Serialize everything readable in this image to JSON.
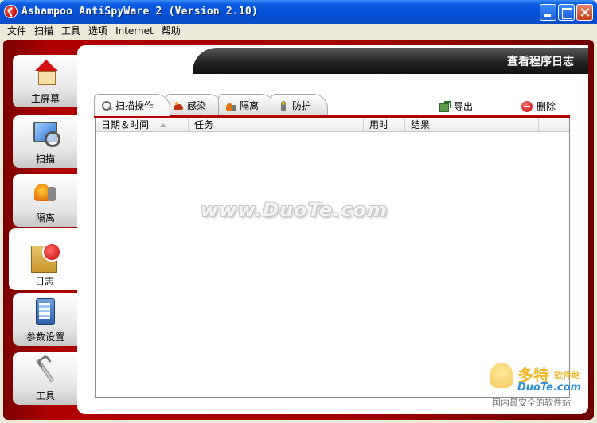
{
  "window": {
    "title": "Ashampoo AntiSpyWare 2 (Version 2.10)"
  },
  "menu": [
    "文件",
    "扫描",
    "工具",
    "选项",
    "Internet",
    "帮助"
  ],
  "sidebar": {
    "items": [
      {
        "label": "主屏幕",
        "icon": "home-icon"
      },
      {
        "label": "扫描",
        "icon": "scan-icon"
      },
      {
        "label": "隔离",
        "icon": "quarantine-icon"
      },
      {
        "label": "日志",
        "icon": "log-icon",
        "active": true
      },
      {
        "label": "参数设置",
        "icon": "settings-icon"
      },
      {
        "label": "工具",
        "icon": "tools-icon"
      }
    ]
  },
  "header": {
    "title": "查看程序日志"
  },
  "tabs": [
    {
      "label": "扫描操作",
      "icon": "magnifier-icon",
      "active": true
    },
    {
      "label": "感染",
      "icon": "bug-icon"
    },
    {
      "label": "隔离",
      "icon": "quarantine-icon"
    },
    {
      "label": "防护",
      "icon": "shield-icon"
    }
  ],
  "actions": {
    "export": "导出",
    "delete": "删除"
  },
  "table": {
    "columns": [
      "日期＆时间",
      "任务",
      "用时",
      "结果"
    ],
    "rows": []
  },
  "watermark": "www.DuoTe.com",
  "corner_logo": {
    "brand": "多特",
    "sub": "软件站",
    "url": "DuoTe.com",
    "tag": "国内最安全的软件站"
  },
  "colors": {
    "frame_red": "#b00000",
    "header_dark": "#222222",
    "titlebar_blue": "#0550d6"
  }
}
